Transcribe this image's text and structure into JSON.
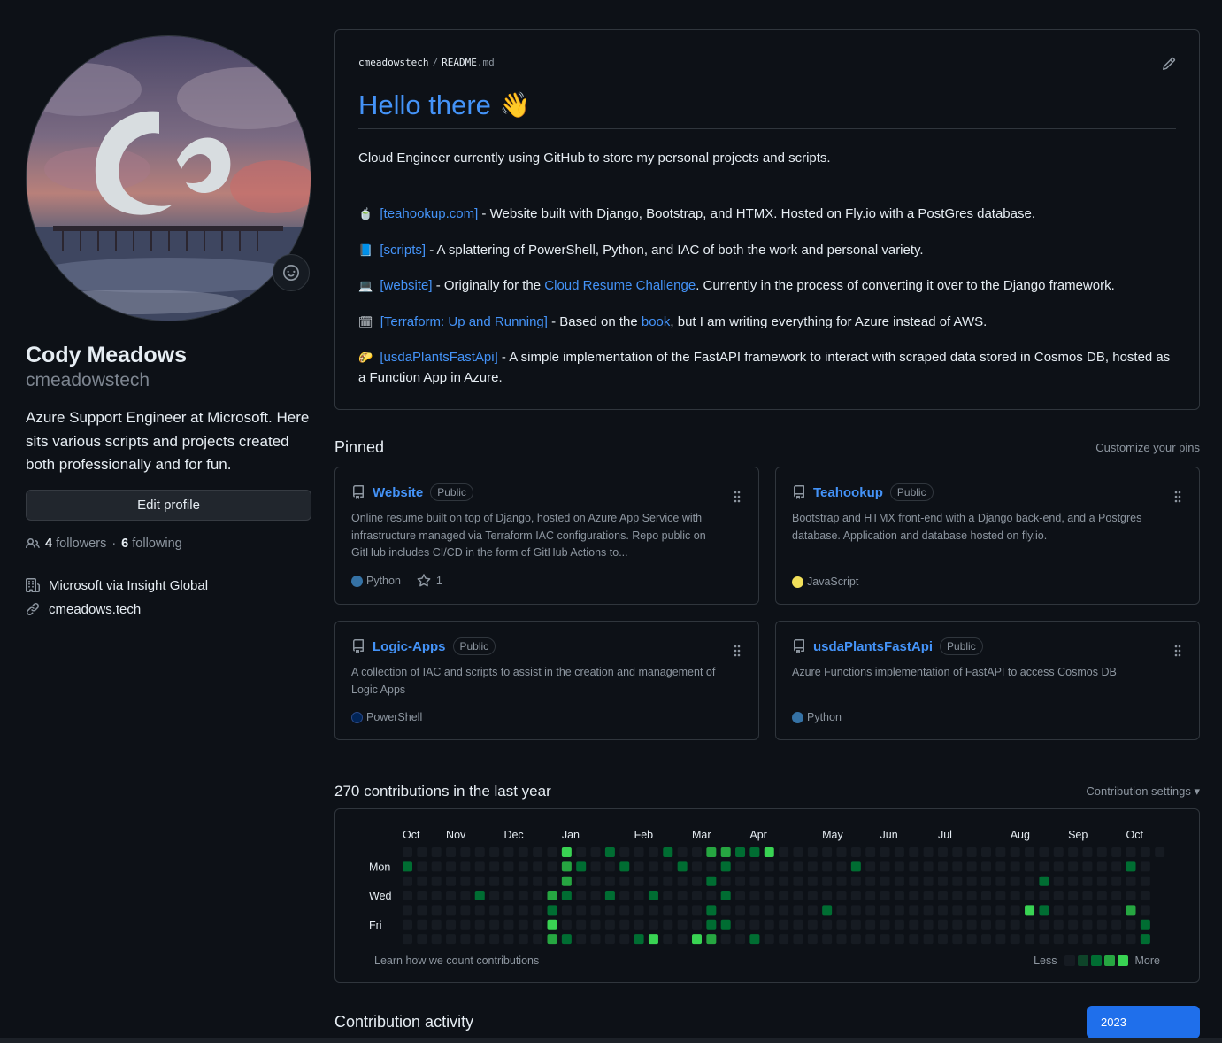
{
  "profile": {
    "full_name": "Cody Meadows",
    "login": "cmeadowstech",
    "bio": "Azure Support Engineer at Microsoft. Here sits various scripts and projects created both professionally and for fun.",
    "edit_label": "Edit profile",
    "followers_count": "4",
    "followers_label": "followers",
    "separator": "·",
    "following_count": "6",
    "following_label": "following",
    "company": "Microsoft via Insight Global",
    "website": "cmeadows.tech"
  },
  "readme": {
    "owner": "cmeadowstech",
    "slash": "/",
    "file": "README",
    "ext": ".md",
    "heading": "Hello there",
    "heading_emoji": "👋",
    "intro": "Cloud Engineer currently using GitHub to store my personal projects and scripts.",
    "items": [
      {
        "emoji": "🍵",
        "link": "[teahookup.com]",
        "text": " - Website built with Django, Bootstrap, and HTMX. Hosted on Fly.io with a PostGres database."
      },
      {
        "emoji": "📘",
        "link": "[scripts]",
        "text": " - A splattering of PowerShell, Python, and IAC of both the work and personal variety."
      },
      {
        "emoji": "💻",
        "link": "[website]",
        "text_a": " - Originally for the ",
        "link2": "Cloud Resume Challenge",
        "text_b": ". Currently in the process of converting it over to the Django framework."
      },
      {
        "emoji": "🗓",
        "link": "[Terraform: Up and Running]",
        "text_a": " - Based on the ",
        "link2": "book",
        "text_b": ", but I am writing everything for Azure instead of AWS."
      },
      {
        "emoji": "🌮",
        "link": "[usdaPlantsFastApi]",
        "text": " - A simple implementation of the FastAPI framework to interact with scraped data stored in Cosmos DB, hosted as a Function App in Azure."
      }
    ]
  },
  "pinned": {
    "title": "Pinned",
    "customize": "Customize your pins",
    "repos": [
      {
        "name": "Website",
        "visibility": "Public",
        "desc": "Online resume built on top of Django, hosted on Azure App Service with infrastructure managed via Terraform IAC configurations. Repo public on GitHub includes CI/CD in the form of GitHub Actions to...",
        "lang": "Python",
        "lang_color": "#3572A5",
        "stars": "1"
      },
      {
        "name": "Teahookup",
        "visibility": "Public",
        "desc": "Bootstrap and HTMX front-end with a Django back-end, and a Postgres database. Application and database hosted on fly.io.",
        "lang": "JavaScript",
        "lang_color": "#f1e05a"
      },
      {
        "name": "Logic-Apps",
        "visibility": "Public",
        "desc": "A collection of IAC and scripts to assist in the creation and management of Logic Apps",
        "lang": "PowerShell",
        "lang_color": "#012456"
      },
      {
        "name": "usdaPlantsFastApi",
        "visibility": "Public",
        "desc": "Azure Functions implementation of FastAPI to access Cosmos DB",
        "lang": "Python",
        "lang_color": "#3572A5"
      }
    ]
  },
  "contributions": {
    "title": "270 contributions in the last year",
    "settings": "Contribution settings",
    "months": [
      "Oct",
      "Nov",
      "Dec",
      "Jan",
      "Feb",
      "Mar",
      "Apr",
      "May",
      "Jun",
      "Jul",
      "Aug",
      "Sep",
      "Oct"
    ],
    "days": [
      "Mon",
      "Wed",
      "Fri"
    ],
    "learn": "Learn how we count contributions",
    "less": "Less",
    "more": "More",
    "colors": [
      "#161b22",
      "#0e4429",
      "#006d32",
      "#26a641",
      "#39d353"
    ]
  },
  "activity": {
    "title": "Contribution activity",
    "year": "2023"
  }
}
